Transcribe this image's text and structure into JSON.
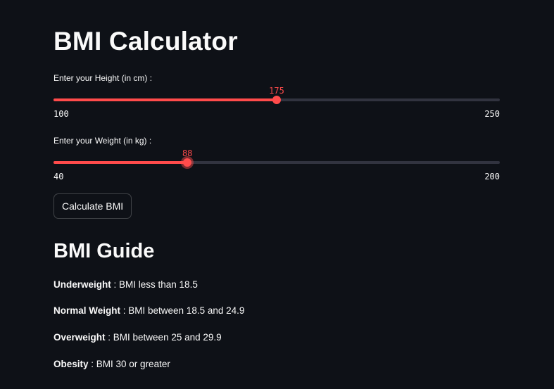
{
  "title": "BMI Calculator",
  "accent_color": "#ff4b4b",
  "height_slider": {
    "label": "Enter your Height (in cm) :",
    "value": 175,
    "min": 100,
    "max": 250
  },
  "weight_slider": {
    "label": "Enter your Weight (in kg) :",
    "value": 88,
    "min": 40,
    "max": 200
  },
  "calculate_button": {
    "label": "Calculate BMI"
  },
  "guide": {
    "title": "BMI Guide",
    "items": [
      {
        "category": "Underweight",
        "description": " : BMI less than 18.5"
      },
      {
        "category": "Normal Weight",
        "description": " : BMI between 18.5 and 24.9"
      },
      {
        "category": "Overweight",
        "description": " : BMI between 25 and 29.9"
      },
      {
        "category": "Obesity",
        "description": " : BMI 30 or greater"
      }
    ]
  }
}
